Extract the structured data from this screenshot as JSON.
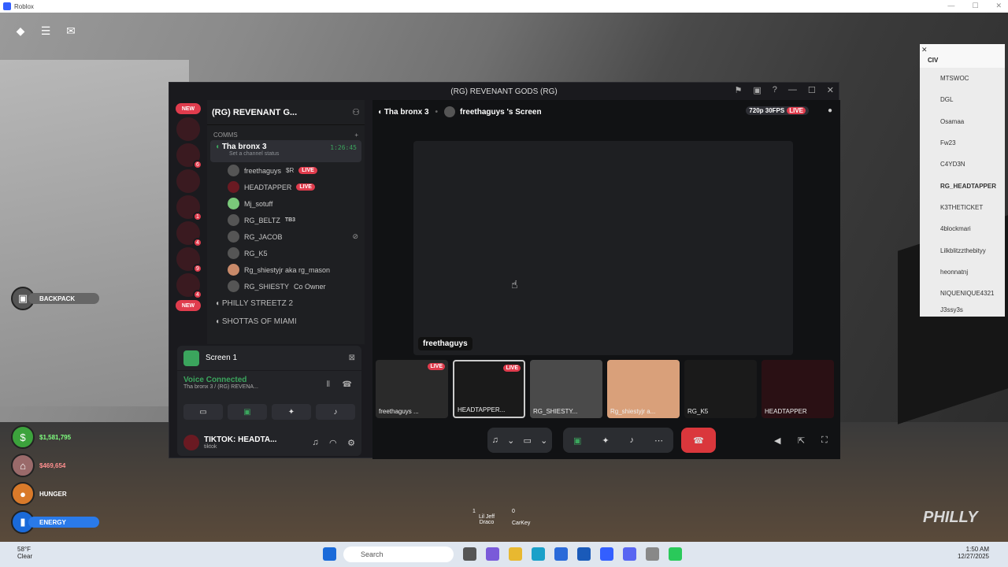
{
  "window": {
    "title": "Roblox"
  },
  "discord": {
    "title": "(RG) REVENANT GODS (RG)",
    "server_name": "(RG) REVENANT G...",
    "category": "COMMS",
    "voice_channel": {
      "name": "Tha bronx 3",
      "status": "Set a channel status",
      "timer": "1:26:45"
    },
    "users": [
      {
        "name": "freethaguys",
        "extra": "$R",
        "live": "LIVE"
      },
      {
        "name": "HEADTAPPER",
        "extra": "",
        "live": "LIVE"
      },
      {
        "name": "Mj_sotuff",
        "extra": "",
        "live": ""
      },
      {
        "name": "RG_BELTZ",
        "extra": "TB3",
        "live": ""
      },
      {
        "name": "RG_JACOB",
        "extra": "",
        "live": ""
      },
      {
        "name": "RG_K5",
        "extra": "",
        "live": ""
      },
      {
        "name": "Rg_shiestyjr aka rg_mason",
        "extra": "",
        "live": ""
      },
      {
        "name": "RG_SHIESTY",
        "extra": "Co Owner",
        "live": ""
      }
    ],
    "channels": [
      "PHILLY STREETZ 2",
      "SHOTTAS OF MIAMI"
    ],
    "rail_badges": [
      "NEW",
      "6",
      "1",
      "4",
      "9",
      "4",
      "NEW"
    ],
    "panel": {
      "screen": "Screen 1",
      "voice_status": "Voice Connected",
      "voice_location": "Tha bronx 3 / (RG) REVENA...",
      "me_name": "TIKTOK: HEADTA...",
      "me_status": "tiktok"
    },
    "stage": {
      "channel": "Tha bronx 3",
      "screen_title": "freethaguys 's Screen",
      "quality": "720p 30FPS",
      "live": "LIVE",
      "screen_label": "freethaguys"
    },
    "tiles": [
      {
        "label": "freethaguys ...",
        "live": "LIVE"
      },
      {
        "label": "HEADTAPPER...",
        "live": "LIVE"
      },
      {
        "label": "RG_SHIESTY...",
        "live": ""
      },
      {
        "label": "Rg_shiestyjr a...",
        "live": ""
      },
      {
        "label": "RG_K5",
        "live": ""
      },
      {
        "label": "HEADTAPPER",
        "live": ""
      }
    ]
  },
  "civ": {
    "header": "CIV",
    "players": [
      "MTSWOC",
      "DGL",
      "Osamaa",
      "Fw23",
      "C4YD3N",
      "RG_HEADTAPPER",
      "K3THETICKET",
      "4blockmari",
      "Lilkblitzzthebityy",
      "heonnatnj",
      "NIQUENIQUE4321",
      "J3ssy3s"
    ]
  },
  "hud": {
    "backpack": "BACKPACK",
    "cash": "$1,581,795",
    "bank": "$469,654",
    "hunger": "HUNGER",
    "energy": "ENERGY"
  },
  "hotbar": {
    "slot1_num": "1",
    "slot1": "Lil Jeff Draco",
    "slot2_num": "0",
    "slot2": "CarKey"
  },
  "watermark": "PHILLY",
  "taskbar": {
    "weather_temp": "58°F",
    "weather_cond": "Clear",
    "search": "Search",
    "time": "1:50 AM",
    "date": "12/27/2025"
  }
}
